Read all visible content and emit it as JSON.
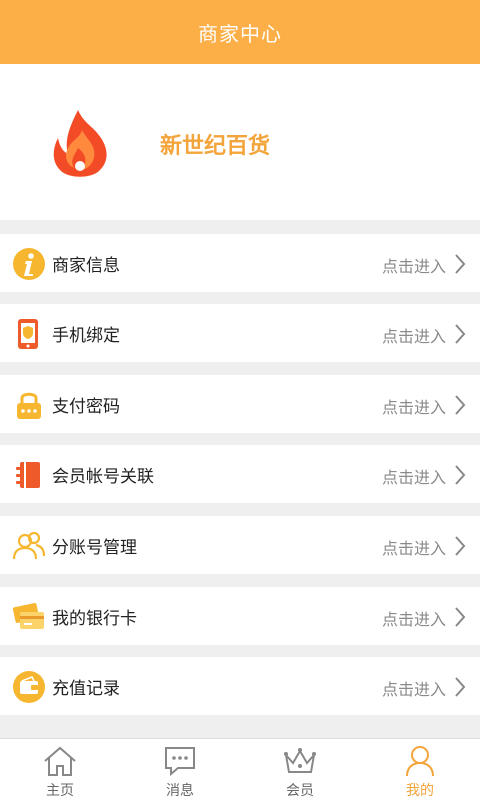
{
  "header": {
    "title": "商家中心"
  },
  "merchant": {
    "name": "新世纪百货",
    "logo_icon": "flame-logo-icon"
  },
  "menu": {
    "action_text": "点击进入",
    "items": [
      {
        "label": "商家信息",
        "icon": "info-icon"
      },
      {
        "label": "手机绑定",
        "icon": "phone-shield-icon"
      },
      {
        "label": "支付密码",
        "icon": "lock-icon"
      },
      {
        "label": "会员帐号关联",
        "icon": "notebook-icon"
      },
      {
        "label": "分账号管理",
        "icon": "users-icon"
      },
      {
        "label": "我的银行卡",
        "icon": "bank-card-icon"
      },
      {
        "label": "充值记录",
        "icon": "wallet-icon"
      }
    ]
  },
  "tabs": [
    {
      "label": "主页",
      "icon": "home-icon"
    },
    {
      "label": "消息",
      "icon": "message-icon"
    },
    {
      "label": "会员",
      "icon": "crown-icon"
    },
    {
      "label": "我的",
      "icon": "user-icon",
      "active": true
    }
  ],
  "colors": {
    "accent": "#fcae47",
    "merchant_text": "#f3a43b",
    "logo": "#f24b25"
  }
}
